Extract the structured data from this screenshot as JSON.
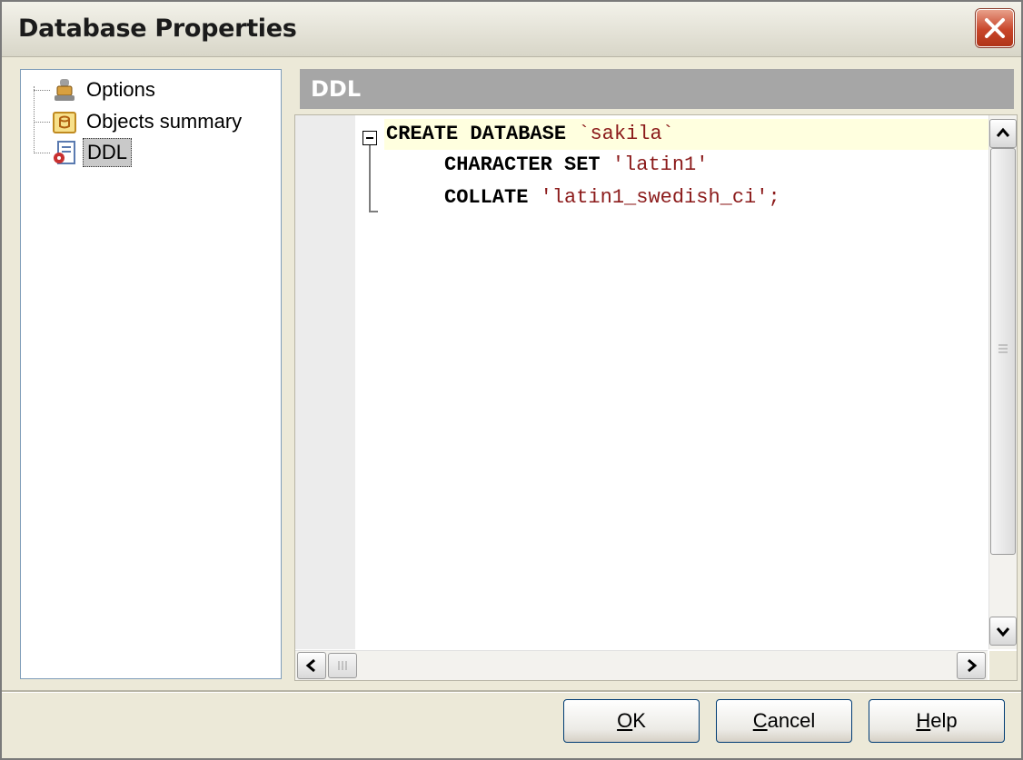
{
  "window": {
    "title": "Database Properties"
  },
  "tree": {
    "items": [
      {
        "label": "Options",
        "icon": "options-icon"
      },
      {
        "label": "Objects summary",
        "icon": "objects-summary-icon"
      },
      {
        "label": "DDL",
        "icon": "ddl-icon",
        "selected": true
      }
    ]
  },
  "ddl": {
    "header": "DDL",
    "code": [
      {
        "kw": "CREATE DATABASE",
        "val": "`sakila`"
      },
      {
        "kw": "CHARACTER SET",
        "val": "'latin1'"
      },
      {
        "kw": "COLLATE",
        "val": "'latin1_swedish_ci';"
      }
    ]
  },
  "buttons": {
    "ok": {
      "accel": "O",
      "rest": "K"
    },
    "cancel": {
      "accel": "C",
      "rest": "ancel"
    },
    "help": {
      "accel": "H",
      "rest": "elp"
    }
  },
  "colors": {
    "keyword": "#000000",
    "string": "#8b1a1a",
    "active_line": "#ffffdf",
    "header_bg": "#a6a6a6"
  }
}
